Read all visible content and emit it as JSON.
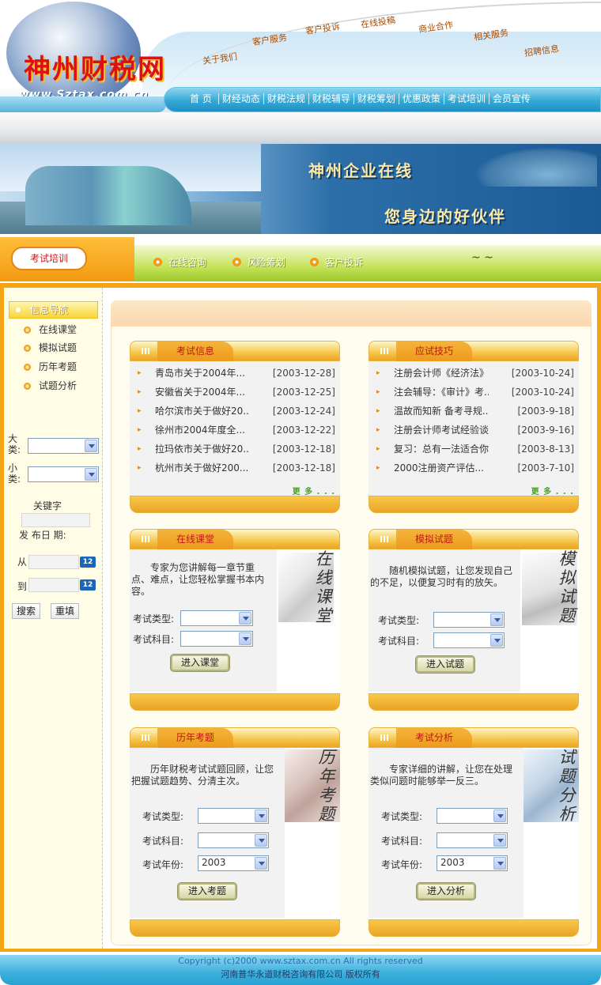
{
  "header": {
    "logo_text": "神州财税网",
    "site_url": "www.Sztax.com.cn",
    "top_tabs": [
      "关于我们",
      "客户服务",
      "客户投诉",
      "在线投稿",
      "商业合作",
      "相关服务",
      "招聘信息"
    ],
    "nav": [
      "首  页",
      "财经动态",
      "财税法规",
      "财税辅导",
      "财税筹划",
      "优惠政策",
      "考试培训",
      "会员宣传"
    ]
  },
  "banner": {
    "line1": "神州企业在线",
    "line2": "您身边的好伙伴"
  },
  "section": {
    "title": "考试培训",
    "links": [
      "在线咨询",
      "风险筹划",
      "客户投诉"
    ]
  },
  "sidebar": {
    "heading": "信息导航",
    "items": [
      "在线课堂",
      "模拟试题",
      "历年考题",
      "试题分析"
    ],
    "big_cat": "大类:",
    "small_cat": "小类:",
    "keyword": "关键字",
    "pubdate": "发 布日 期:",
    "from": "从",
    "to": "到",
    "cal_label": "12",
    "search_btn": "搜索",
    "reset_btn": "重填"
  },
  "exam_info": {
    "title": "考试信息",
    "more": "更 多 . . .",
    "rows": [
      {
        "t": "青岛市关于2004年...",
        "d": "[2003-12-28]"
      },
      {
        "t": "安徽省关于2004年...",
        "d": "[2003-12-25]"
      },
      {
        "t": "哈尔滨市关于做好20...",
        "d": "[2003-12-24]"
      },
      {
        "t": "徐州市2004年度全...",
        "d": "[2003-12-22]"
      },
      {
        "t": "拉玛依市关于做好20...",
        "d": "[2003-12-18]"
      },
      {
        "t": "杭州市关于做好200...",
        "d": "[2003-12-18]"
      }
    ]
  },
  "exam_tips": {
    "title": "应试技巧",
    "more": "更 多 . . .",
    "rows": [
      {
        "t": "注册会计师《经济法》...",
        "d": "[2003-10-24]"
      },
      {
        "t": "注会辅导：《审计》考...",
        "d": "[2003-10-24]"
      },
      {
        "t": "温故而知新 备考寻规...",
        "d": "[2003-9-18]"
      },
      {
        "t": "注册会计师考试经验谈...",
        "d": "[2003-9-16]"
      },
      {
        "t": "复习：总有一法适合你",
        "d": "[2003-8-13]"
      },
      {
        "t": "2000注册资产评估...",
        "d": "[2003-7-10]"
      }
    ]
  },
  "online_class": {
    "title": "在线课堂",
    "desc": "专家为您讲解每一章节重点、难点，让您轻松掌握书本内容。",
    "img_text": "在线课堂",
    "label_type": "考试类型:",
    "label_subject": "考试科目:",
    "button": "进入课堂"
  },
  "mock_exam": {
    "title": "模拟试题",
    "desc": "随机模拟试题，让您发现自己的不足，以便复习时有的放矢。",
    "img_text": "模拟试题",
    "label_type": "考试类型:",
    "label_subject": "考试科目:",
    "button": "进入试题"
  },
  "past_exam": {
    "title": "历年考题",
    "desc": "历年财税考试试题回顾，让您把握试题趋势、分清主次。",
    "img_text": "历年考题",
    "label_type": "考试类型:",
    "label_subject": "考试科目:",
    "label_year": "考试年份:",
    "year_value": "2003",
    "button": "进入考题"
  },
  "analysis": {
    "title": "考试分析",
    "desc": "专家详细的讲解，让您在处理类似问题时能够举一反三。",
    "img_text": "试题分析",
    "label_type": "考试类型:",
    "label_subject": "考试科目:",
    "label_year": "考试年份:",
    "year_value": "2003",
    "button": "进入分析"
  },
  "footer": {
    "copyright": "Copyright (c)2000 www.sztax.com.cn All rights reserved",
    "company": "河南普华永道财税咨询有限公司      版权所有"
  }
}
